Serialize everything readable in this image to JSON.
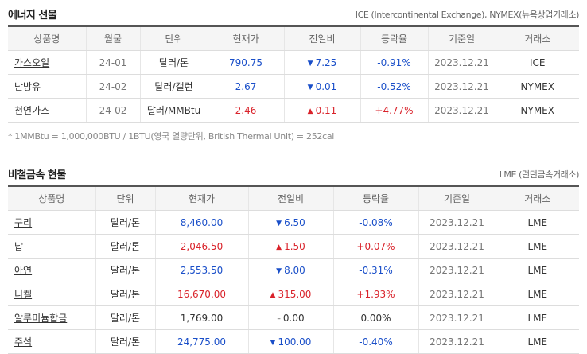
{
  "energy": {
    "title": "에너지 선물",
    "source": "ICE (Intercontinental Exchange), NYMEX(뉴욕상업거래소)",
    "headers": [
      "상품명",
      "월물",
      "단위",
      "현재가",
      "전일비",
      "등락율",
      "기준일",
      "거래소"
    ],
    "rows": [
      {
        "name": "가스오일",
        "month": "24-01",
        "unit": "달러/톤",
        "price": "790.75",
        "change": "7.25",
        "dir": "down",
        "rate": "-0.91%",
        "date": "2023.12.21",
        "exchange": "ICE"
      },
      {
        "name": "난방유",
        "month": "24-02",
        "unit": "달러/갤런",
        "price": "2.67",
        "change": "0.01",
        "dir": "down",
        "rate": "-0.52%",
        "date": "2023.12.21",
        "exchange": "NYMEX"
      },
      {
        "name": "천연가스",
        "month": "24-02",
        "unit": "달러/MMBtu",
        "price": "2.46",
        "change": "0.11",
        "dir": "up",
        "rate": "+4.77%",
        "date": "2023.12.21",
        "exchange": "NYMEX"
      }
    ],
    "note": "* 1MMBtu = 1,000,000BTU / 1BTU(영국 열량단위, British Thermal Unit) = 252cal"
  },
  "metals": {
    "title": "비철금속 현물",
    "source": "LME (런던금속거래소)",
    "headers": [
      "상품명",
      "단위",
      "현재가",
      "전일비",
      "등락율",
      "기준일",
      "거래소"
    ],
    "rows": [
      {
        "name": "구리",
        "unit": "달러/톤",
        "price": "8,460.00",
        "change": "6.50",
        "dir": "down",
        "rate": "-0.08%",
        "date": "2023.12.21",
        "exchange": "LME"
      },
      {
        "name": "납",
        "unit": "달러/톤",
        "price": "2,046.50",
        "change": "1.50",
        "dir": "up",
        "rate": "+0.07%",
        "date": "2023.12.21",
        "exchange": "LME"
      },
      {
        "name": "아연",
        "unit": "달러/톤",
        "price": "2,553.50",
        "change": "8.00",
        "dir": "down",
        "rate": "-0.31%",
        "date": "2023.12.21",
        "exchange": "LME"
      },
      {
        "name": "니켈",
        "unit": "달러/톤",
        "price": "16,670.00",
        "change": "315.00",
        "dir": "up",
        "rate": "+1.93%",
        "date": "2023.12.21",
        "exchange": "LME"
      },
      {
        "name": "알루미늄합금",
        "unit": "달러/톤",
        "price": "1,769.00",
        "change": "0.00",
        "dir": "flat",
        "rate": "0.00%",
        "date": "2023.12.21",
        "exchange": "LME"
      },
      {
        "name": "주석",
        "unit": "달러/톤",
        "price": "24,775.00",
        "change": "100.00",
        "dir": "down",
        "rate": "-0.40%",
        "date": "2023.12.21",
        "exchange": "LME"
      }
    ]
  },
  "icons": {
    "up": "triangle-up-icon",
    "down": "triangle-down-icon",
    "flat": "dash-icon"
  },
  "colors": {
    "up": "#d9222a",
    "down": "#1a4fc9",
    "header_bg": "#f5f5f5"
  }
}
